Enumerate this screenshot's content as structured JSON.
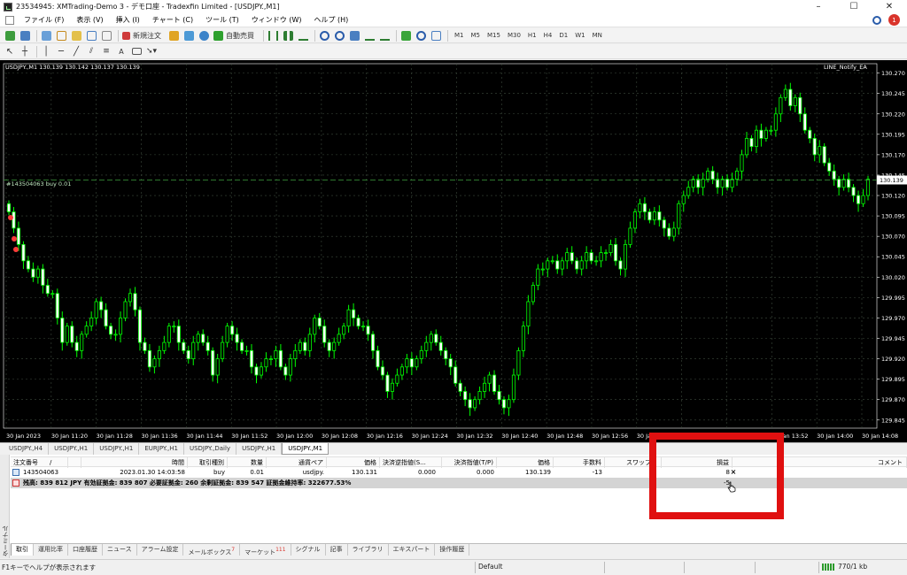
{
  "window": {
    "title": "23534945: XMTrading-Demo 3 - デモ口座 - Tradexfin Limited - [USDJPY.,M1]",
    "controls": [
      "–",
      "☐",
      "✕"
    ]
  },
  "menu": [
    "ファイル (F)",
    "表示 (V)",
    "挿入 (I)",
    "チャート (C)",
    "ツール (T)",
    "ウィンドウ (W)",
    "ヘルプ (H)"
  ],
  "notifications": {
    "count": "1"
  },
  "toolbar1": {
    "new_order": "新規注文",
    "auto_trading": "自動売買",
    "timeframes": [
      "M1",
      "M5",
      "M15",
      "M30",
      "H1",
      "H4",
      "D1",
      "W1",
      "MN"
    ]
  },
  "toolbar2": {
    "text_tool": "A"
  },
  "chart": {
    "header": "USDJPY.,M1  130.139 130.142 130.137 130.139",
    "ea_label": "LINE_Notify_EA",
    "order_line_label": "#143504063 buy 0.01",
    "current_price": "130.139",
    "price_ticks": [
      "130.270",
      "130.245",
      "130.220",
      "130.195",
      "130.170",
      "130.145",
      "130.120",
      "130.095",
      "130.070",
      "130.045",
      "130.020",
      "129.995",
      "129.970",
      "129.945",
      "129.920",
      "129.895",
      "129.870",
      "129.845"
    ],
    "time_ticks": [
      "30 Jan 2023",
      "30 Jan 11:20",
      "30 Jan 11:28",
      "30 Jan 11:36",
      "30 Jan 11:44",
      "30 Jan 11:52",
      "30 Jan 12:00",
      "30 Jan 12:08",
      "30 Jan 12:16",
      "30 Jan 12:24",
      "30 Jan 12:32",
      "30 Jan 12:40",
      "30 Jan 12:48",
      "30 Jan 12:56",
      "30 Jan 13:04",
      "30 Jan 13:12",
      "30 Jan 13:20",
      "30 Jan 13:52",
      "30 Jan 14:00",
      "30 Jan 14:08"
    ],
    "colors": {
      "background": "#000000",
      "candle": "#00ff00",
      "grid": "#3c4a3c",
      "order_line": "#3fa03f"
    }
  },
  "chart_tabs": [
    "USDJPY.,H4",
    "USDJPY.,H1",
    "USDJPY.,H1",
    "EURJPY.,H1",
    "USDJPY.,Daily",
    "USDJPY.,H1",
    "USDJPY.,M1"
  ],
  "terminal": {
    "side_label": "ターミナル",
    "columns": [
      "注文番号",
      "/",
      "時間",
      "取引種別",
      "数量",
      "通貨ペア",
      "価格",
      "決済逆指値(S...",
      "決済指値(T/P)",
      "価格",
      "手数料",
      "スワップ",
      "損益",
      "コメント"
    ],
    "order": {
      "ticket": "143504063",
      "time": "2023.01.30 14:03:58",
      "type": "buy",
      "volume": "0.01",
      "symbol": "usdjpy.",
      "price": "130.131",
      "sl": "0.000",
      "tp": "0.000",
      "current": "130.139",
      "commission": "-13",
      "profit": "8",
      "close": "×"
    },
    "balance_line": "残高: 839 812 JPY  有効証拠金: 839 807  必要証拠金: 260  余剰証拠金: 839 547  証拠金維持率: 322677.53%",
    "total_profit": "-5"
  },
  "terminal_tabs": [
    {
      "label": "取引",
      "badge": ""
    },
    {
      "label": "運用比率",
      "badge": ""
    },
    {
      "label": "口座履歴",
      "badge": ""
    },
    {
      "label": "ニュース",
      "badge": ""
    },
    {
      "label": "アラーム設定",
      "badge": ""
    },
    {
      "label": "メールボックス",
      "badge": "7"
    },
    {
      "label": "マーケット",
      "badge": "111"
    },
    {
      "label": "シグナル",
      "badge": ""
    },
    {
      "label": "記事",
      "badge": ""
    },
    {
      "label": "ライブラリ",
      "badge": ""
    },
    {
      "label": "エキスパート",
      "badge": ""
    },
    {
      "label": "操作履歴",
      "badge": ""
    }
  ],
  "status": {
    "help": "F1キーでヘルプが表示されます",
    "profile": "Default",
    "traffic": "770/1 kb"
  },
  "chart_data": {
    "type": "candlestick",
    "ylim": [
      129.835,
      130.275
    ],
    "close": [
      130.1,
      130.08,
      130.06,
      130.04,
      130.03,
      130.02,
      130.03,
      130.01,
      130.0,
      130.0,
      129.97,
      129.94,
      129.96,
      129.94,
      129.93,
      129.95,
      129.96,
      129.97,
      129.99,
      129.98,
      129.96,
      129.95,
      129.95,
      129.97,
      129.99,
      130.0,
      129.98,
      129.94,
      129.93,
      129.91,
      129.92,
      129.93,
      129.94,
      129.96,
      129.96,
      129.94,
      129.93,
      129.92,
      129.94,
      129.95,
      129.94,
      129.93,
      129.9,
      129.92,
      129.94,
      129.96,
      129.95,
      129.94,
      129.93,
      129.93,
      129.91,
      129.9,
      129.91,
      129.92,
      129.92,
      129.93,
      129.91,
      129.9,
      129.92,
      129.93,
      129.94,
      129.93,
      129.95,
      129.97,
      129.96,
      129.94,
      129.93,
      129.94,
      129.95,
      129.96,
      129.98,
      129.97,
      129.96,
      129.96,
      129.95,
      129.93,
      129.91,
      129.9,
      129.88,
      129.89,
      129.9,
      129.91,
      129.92,
      129.91,
      129.92,
      129.93,
      129.94,
      129.95,
      129.94,
      129.93,
      129.92,
      129.91,
      129.89,
      129.88,
      129.87,
      129.86,
      129.87,
      129.88,
      129.89,
      129.9,
      129.88,
      129.87,
      129.86,
      129.87,
      129.9,
      129.93,
      129.96,
      129.99,
      130.01,
      130.03,
      130.03,
      130.04,
      130.04,
      130.03,
      130.04,
      130.05,
      130.04,
      130.03,
      130.04,
      130.05,
      130.04,
      130.04,
      130.05,
      130.05,
      130.06,
      130.04,
      130.03,
      130.06,
      130.08,
      130.1,
      130.11,
      130.1,
      130.09,
      130.1,
      130.09,
      130.08,
      130.07,
      130.08,
      130.11,
      130.12,
      130.13,
      130.14,
      130.13,
      130.14,
      130.15,
      130.14,
      130.13,
      130.14,
      130.13,
      130.14,
      130.15,
      130.17,
      130.19,
      130.18,
      130.2,
      130.19,
      130.2,
      130.2,
      130.22,
      130.24,
      130.25,
      130.23,
      130.24,
      130.22,
      130.2,
      130.19,
      130.17,
      130.18,
      130.16,
      130.15,
      130.14,
      130.13,
      130.14,
      130.13,
      130.12,
      130.11,
      130.12,
      130.14
    ]
  }
}
